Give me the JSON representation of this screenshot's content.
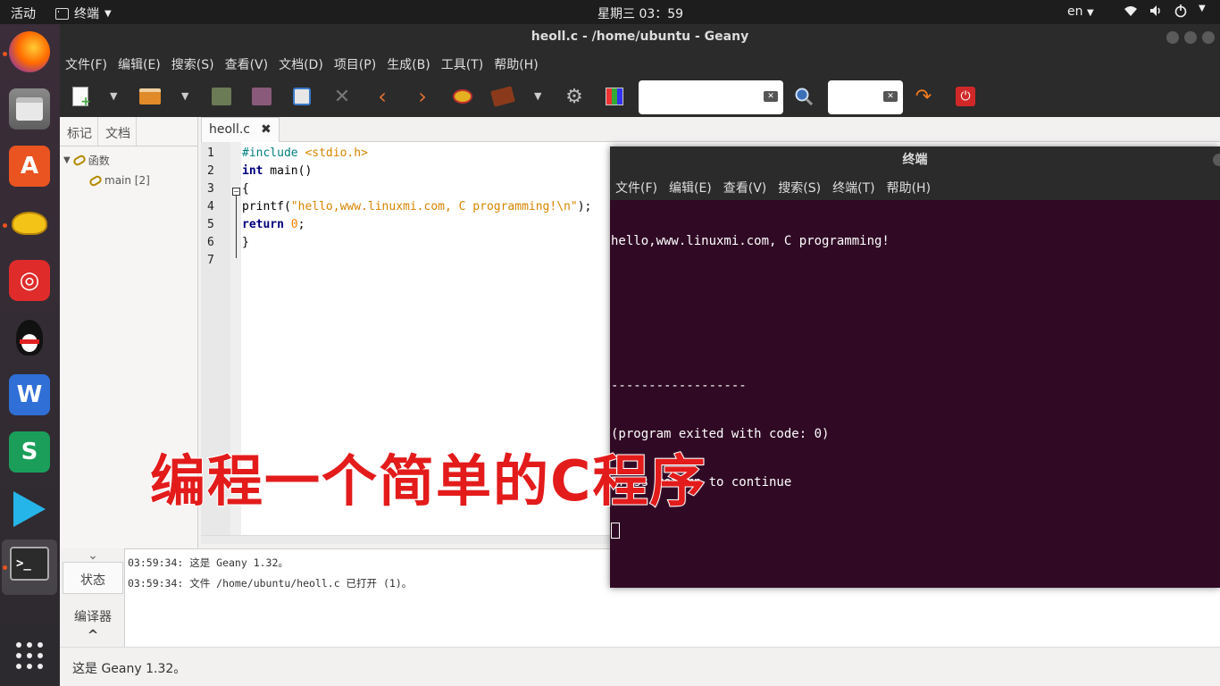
{
  "topbar": {
    "activities": "活动",
    "app_name": "终端",
    "clock": "星期三 03：59",
    "lang": "en"
  },
  "dock": {
    "items": [
      {
        "name": "firefox",
        "icon": "firefox-icon"
      },
      {
        "name": "files",
        "icon": "files-icon"
      },
      {
        "name": "software",
        "icon": "software-store-icon"
      },
      {
        "name": "genie",
        "icon": "genie-lamp-icon"
      },
      {
        "name": "netease-music",
        "icon": "netease-music-icon"
      },
      {
        "name": "qq",
        "icon": "qq-penguin-icon"
      },
      {
        "name": "wps-writer",
        "icon": "wps-writer-icon"
      },
      {
        "name": "wps-spreadsheets",
        "icon": "wps-spreadsheets-icon"
      },
      {
        "name": "video",
        "icon": "video-play-icon"
      },
      {
        "name": "terminal",
        "icon": "terminal-icon"
      },
      {
        "name": "show-apps",
        "icon": "app-grid-icon"
      }
    ],
    "accent": "#e95420"
  },
  "geany": {
    "title": "heoll.c - /home/ubuntu - Geany",
    "menu": [
      "文件(F)",
      "编辑(E)",
      "搜索(S)",
      "查看(V)",
      "文档(D)",
      "项目(P)",
      "生成(B)",
      "工具(T)",
      "帮助(H)"
    ],
    "sidebar": {
      "tabs": [
        "标记",
        "文档"
      ],
      "tree_root": "函数",
      "tree_child": "main [2]"
    },
    "editor_tab": "heoll.c",
    "line_numbers": [
      "1",
      "2",
      "3",
      "4",
      "5",
      "6",
      "7"
    ],
    "code": {
      "l1_directive": "#include",
      "l1_header": "<stdio.h>",
      "l2_kw": "int",
      "l2_rest": " main()",
      "l3": "{",
      "l4_fn": "printf(",
      "l4_str": "\"hello,www.linuxmi.com, C programming!\\n\"",
      "l4_end": ");",
      "l5_kw": "return",
      "l5_num": "0",
      "l5_end": ";",
      "l6": "}"
    },
    "message_tabs": [
      "状态",
      "编译器"
    ],
    "messages": [
      "03:59:34: 这是 Geany 1.32。",
      "03:59:34: 文件 /home/ubuntu/heoll.c 已打开 (1)。"
    ],
    "status": "这是 Geany 1.32。"
  },
  "terminal": {
    "title": "终端",
    "menu": [
      "文件(F)",
      "编辑(E)",
      "查看(V)",
      "搜索(S)",
      "终端(T)",
      "帮助(H)"
    ],
    "lines": [
      "hello,www.linuxmi.com, C programming!",
      "",
      "",
      "------------------",
      "(program exited with code: 0)",
      "Press return to continue"
    ],
    "bg": "#300a24"
  },
  "caption": "编程一个简单的C程序"
}
